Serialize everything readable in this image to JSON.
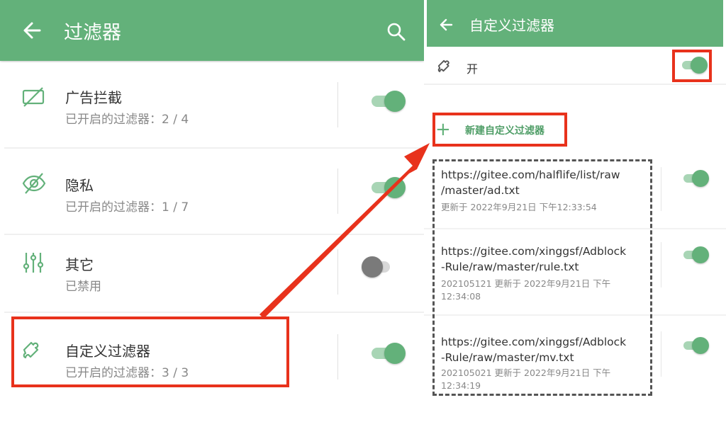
{
  "colors": {
    "accent": "#63b17a",
    "highlight": "#e8321c"
  },
  "left": {
    "header": {
      "title": "过滤器",
      "back_icon": "arrow-left-icon",
      "search_icon": "search-icon"
    },
    "rows": [
      {
        "icon": "ad-off-icon",
        "title": "广告拦截",
        "subtitle": "已开启的过滤器：2 / 4",
        "enabled": true
      },
      {
        "icon": "eye-off-icon",
        "title": "隐私",
        "subtitle": "已开启的过滤器：1 / 7",
        "enabled": true
      },
      {
        "icon": "sliders-icon",
        "title": "其它",
        "subtitle": "已禁用",
        "enabled": false
      },
      {
        "icon": "puzzle-icon",
        "title": "自定义过滤器",
        "subtitle": "已开启的过滤器：3 / 3",
        "enabled": true
      }
    ]
  },
  "right": {
    "header": {
      "title": "自定义过滤器",
      "back_icon": "arrow-left-icon"
    },
    "master": {
      "icon": "puzzle-icon",
      "label": "开",
      "enabled": true
    },
    "new_filter_label": "新建自定义过滤器",
    "filters": [
      {
        "url": "https://gitee.com/halflife/list/raw\n/master/ad.txt",
        "meta": "更新于 2022年9月21日 下午12:33:54",
        "enabled": true
      },
      {
        "url": "https://gitee.com/xinggsf/Adblock\n-Rule/raw/master/rule.txt",
        "meta": "202105121 更新于 2022年9月21日 下午\n12:34:08",
        "enabled": true
      },
      {
        "url": "https://gitee.com/xinggsf/Adblock\n-Rule/raw/master/mv.txt",
        "meta": "202105021 更新于 2022年9月21日 下午\n12:34:19",
        "enabled": true
      }
    ]
  }
}
